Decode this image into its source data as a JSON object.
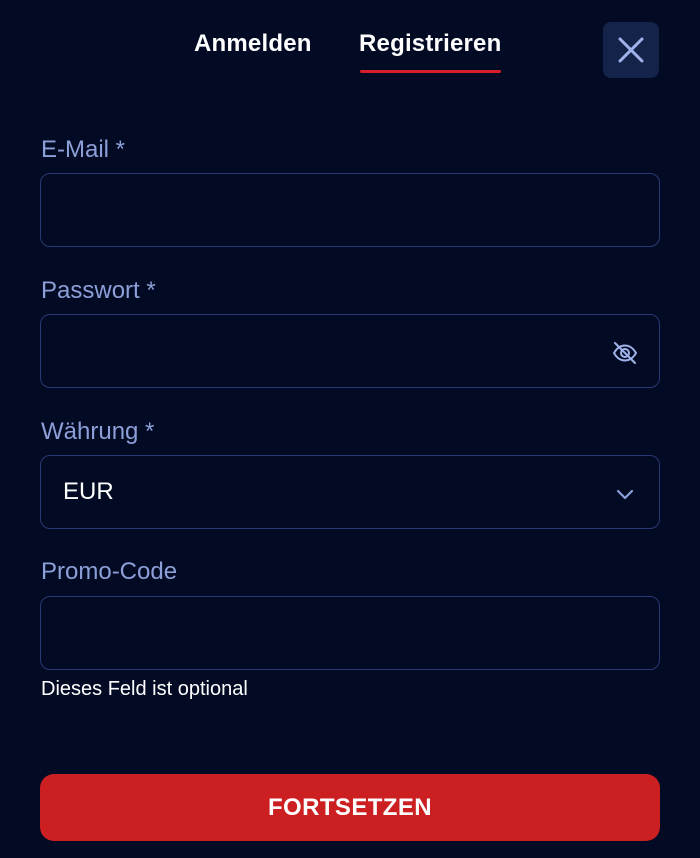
{
  "tabs": {
    "login_label": "Anmelden",
    "register_label": "Registrieren",
    "active": "register"
  },
  "close": {
    "icon": "close-icon"
  },
  "form": {
    "email": {
      "label": "E-Mail *",
      "value": "",
      "placeholder": ""
    },
    "password": {
      "label": "Passwort *",
      "value": "",
      "placeholder": "",
      "icon": "eye-off-icon"
    },
    "currency": {
      "label": "Währung *",
      "selected": "EUR",
      "icon": "chevron-down-icon"
    },
    "promo": {
      "label": "Promo-Code",
      "value": "",
      "placeholder": "",
      "helper": "Dieses Feld ist optional"
    }
  },
  "submit": {
    "label": "FORTSETZEN"
  },
  "colors": {
    "background": "#020b23",
    "accent": "#cc1f22",
    "tab_underline": "#d81d2b",
    "label": "#8d9fd8",
    "border": "#2a3973"
  }
}
